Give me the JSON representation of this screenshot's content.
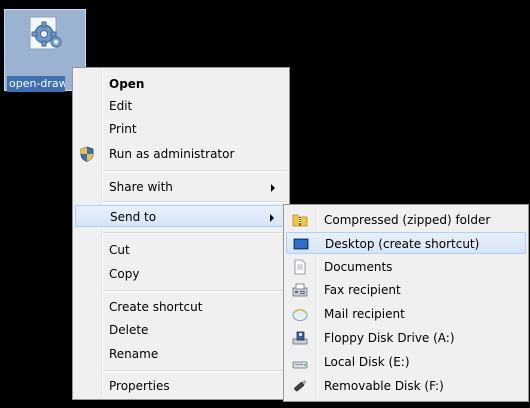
{
  "desktop_icon": {
    "label": "open-draw",
    "icon": "gear-document-icon"
  },
  "context_menu": {
    "items": [
      {
        "label": "Open",
        "bold": true
      },
      {
        "label": "Edit"
      },
      {
        "label": "Print"
      },
      {
        "label": "Run as administrator",
        "icon": "uac-shield-icon"
      },
      {
        "label": "Share with",
        "has_submenu": true
      },
      {
        "label": "Send to",
        "has_submenu": true,
        "highlighted": true
      },
      {
        "label": "Cut"
      },
      {
        "label": "Copy"
      },
      {
        "label": "Create shortcut"
      },
      {
        "label": "Delete"
      },
      {
        "label": "Rename"
      },
      {
        "label": "Properties"
      }
    ]
  },
  "send_to_menu": {
    "items": [
      {
        "label": "Compressed (zipped) folder",
        "icon": "zip-folder-icon"
      },
      {
        "label": "Desktop (create shortcut)",
        "icon": "desktop-icon",
        "highlighted": true
      },
      {
        "label": "Documents",
        "icon": "documents-icon"
      },
      {
        "label": "Fax recipient",
        "icon": "fax-icon"
      },
      {
        "label": "Mail recipient",
        "icon": "mail-icon"
      },
      {
        "label": "Floppy Disk Drive (A:)",
        "icon": "floppy-drive-icon"
      },
      {
        "label": "Local Disk (E:)",
        "icon": "local-disk-icon"
      },
      {
        "label": "Removable Disk (F:)",
        "icon": "removable-disk-icon"
      }
    ]
  },
  "colors": {
    "desktop_background": "#000000",
    "menu_background": "#f0f0f0",
    "highlight_border": "#aecff7",
    "icon_selection": "#9bb3d1"
  }
}
